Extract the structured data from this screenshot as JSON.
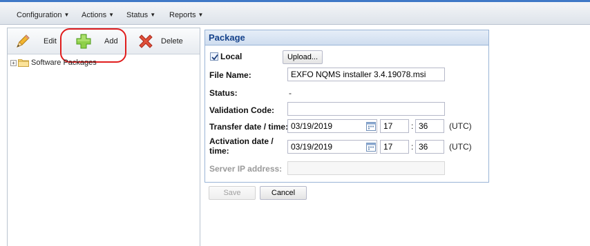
{
  "menu": {
    "items": [
      {
        "label": "Configuration"
      },
      {
        "label": "Actions"
      },
      {
        "label": "Status"
      },
      {
        "label": "Reports"
      }
    ]
  },
  "toolbar": {
    "edit_label": "Edit",
    "add_label": "Add",
    "delete_label": "Delete"
  },
  "tree": {
    "root_label": "Software Packages",
    "expander": "+"
  },
  "package": {
    "title": "Package",
    "local_label": "Local",
    "local_checked": true,
    "upload_label": "Upload...",
    "file_name_label": "File Name:",
    "file_name_value": "EXFO NQMS installer 3.4.19078.msi",
    "status_label": "Status:",
    "status_value": "-",
    "validation_label": "Validation Code:",
    "validation_value": "",
    "transfer_label": "Transfer date / time:",
    "transfer_date": "03/19/2019",
    "transfer_hour": "17",
    "transfer_minute": "36",
    "transfer_tz": "(UTC)",
    "activation_label_1": "Activation date /",
    "activation_label_2": "time:",
    "activation_date": "03/19/2019",
    "activation_hour": "17",
    "activation_minute": "36",
    "activation_tz": "(UTC)",
    "server_ip_label": "Server IP address:",
    "server_ip_value": "",
    "save_label": "Save",
    "cancel_label": "Cancel",
    "colon": ":"
  },
  "colors": {
    "accent": "#3f79c7",
    "highlight": "#e01c1c",
    "panel_title": "#15428b"
  }
}
